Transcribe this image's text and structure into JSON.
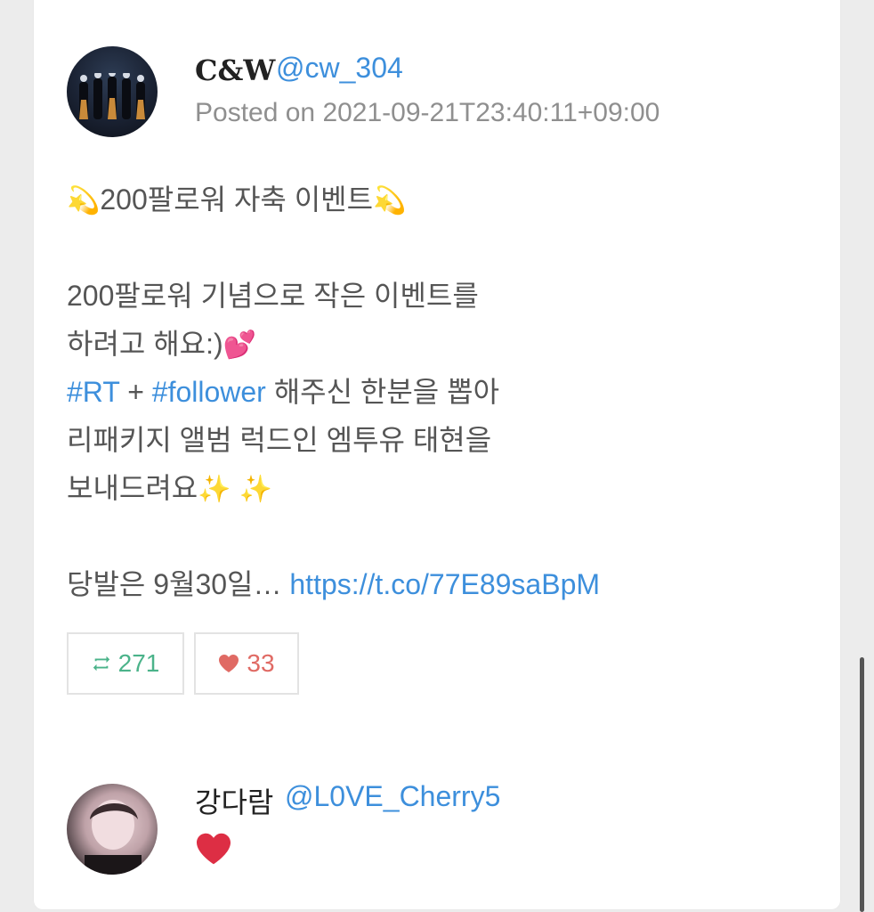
{
  "post": {
    "author_name": "C&W",
    "author_handle": "@cw_304",
    "posted": "Posted on 2021-09-21T23:40:11+09:00",
    "title": "200팔로워 자축 이벤트",
    "line1": "200팔로워 기념으로 작은 이벤트를",
    "line2": "하려고 해요:)",
    "hashtag_rt": "#RT",
    "plus": " + ",
    "hashtag_follower": "#follower",
    "line3_rest": " 해주신 한분을 뽑아",
    "line4": "리패키지 앨범 럭드인 엠투유 태현을",
    "line5": "보내드려요",
    "line6_text": "당발은 9월30일… ",
    "link": "https://t.co/77E89saBpM"
  },
  "stats": {
    "retweets": "271",
    "likes": "33"
  },
  "reply": {
    "name": "강다람",
    "handle": "@L0VE_Cherry5"
  },
  "colors": {
    "link": "#3d8fdc",
    "retweet": "#4bb38a",
    "like": "#e06a64"
  },
  "icons": {
    "title_left": "dizzy-emoji",
    "title_right": "dizzy-emoji",
    "line2_end": "two-hearts-emoji",
    "line5_end": "sparkles-emoji",
    "retweet": "retweet-icon",
    "like": "heart-icon",
    "reply": "red-heart-emoji"
  }
}
